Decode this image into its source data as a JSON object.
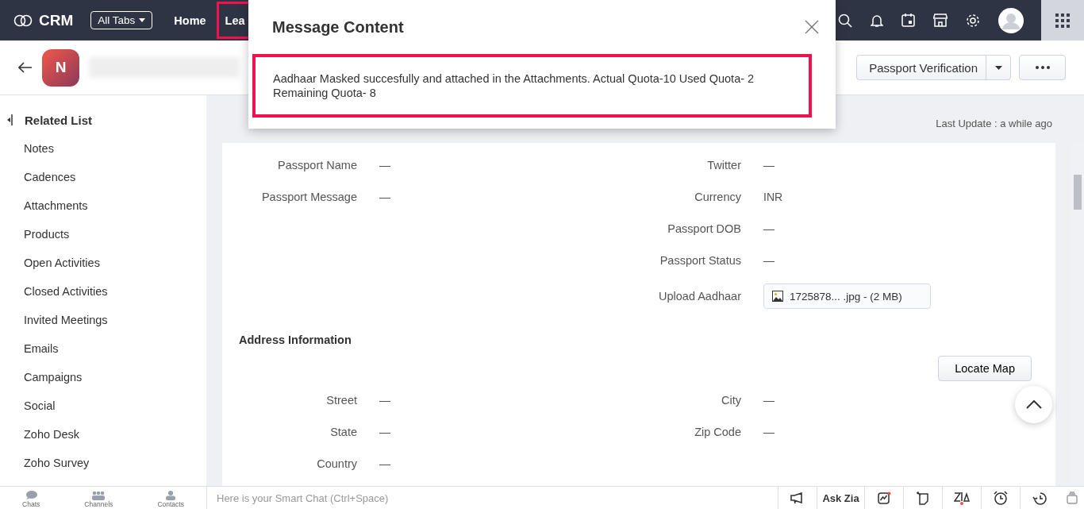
{
  "nav": {
    "brand": "CRM",
    "all_tabs": "All Tabs",
    "tabs": [
      {
        "label": "Home",
        "highlighted": false
      },
      {
        "label": "Lea",
        "highlighted": true
      }
    ]
  },
  "header": {
    "avatar_initial": "N",
    "split_button": "Passport Verification"
  },
  "sidebar": {
    "title": "Related List",
    "items": [
      "Notes",
      "Cadences",
      "Attachments",
      "Products",
      "Open Activities",
      "Closed Activities",
      "Invited Meetings",
      "Emails",
      "Campaigns",
      "Social",
      "Zoho Desk",
      "Zoho Survey"
    ]
  },
  "toolbar": {
    "last_update": "Last Update : a while ago"
  },
  "details": {
    "left": [
      {
        "label": "Passport Name",
        "value": "—",
        "kind": "text"
      },
      {
        "label": "Passport Message",
        "value": "—",
        "kind": "text"
      }
    ],
    "right": [
      {
        "label": "Twitter",
        "value": "—",
        "kind": "text"
      },
      {
        "label": "Currency",
        "value": "INR",
        "kind": "text"
      },
      {
        "label": "Passport DOB",
        "value": "—",
        "kind": "text"
      },
      {
        "label": "Passport Status",
        "value": "—",
        "kind": "text"
      },
      {
        "label": "Upload Aadhaar",
        "value": "1725878...  .jpg - (2 MB)",
        "kind": "file"
      }
    ]
  },
  "address": {
    "title": "Address Information",
    "button": "Locate Map",
    "left": [
      {
        "label": "Street",
        "value": "—"
      },
      {
        "label": "State",
        "value": "—"
      },
      {
        "label": "Country",
        "value": "—"
      }
    ],
    "right": [
      {
        "label": "City",
        "value": "—"
      },
      {
        "label": "Zip Code",
        "value": "—"
      }
    ]
  },
  "bottom_bar": {
    "tabs": [
      "Chats",
      "Channels",
      "Contacts"
    ],
    "smart_chat_placeholder": "Here is your Smart Chat (Ctrl+Space)",
    "ask_zia": "Ask Zia"
  },
  "modal": {
    "title": "Message Content",
    "message": "Aadhaar Masked succesfully and attached in the Attachments. Actual Quota-10 Used Quota- 2 Remaining Quota- 8",
    "highlighted": true
  }
}
